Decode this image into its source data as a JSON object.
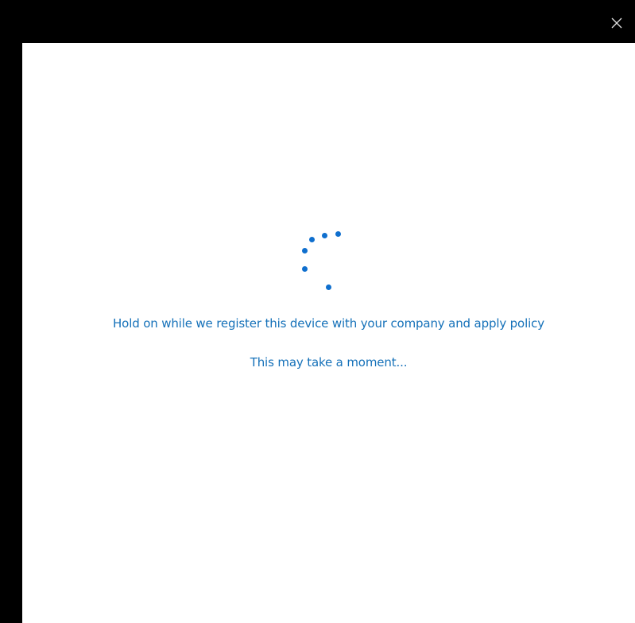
{
  "dialog": {
    "close_icon": "close-icon",
    "message": "Hold on while we register this device with your company and apply policy",
    "submessage": "This may take a moment...",
    "spinner_icon": "loading-spinner-icon"
  },
  "colors": {
    "accent": "#1571b9",
    "spinner": "#0f6fce",
    "titlebar": "#000000",
    "background": "#ffffff"
  }
}
